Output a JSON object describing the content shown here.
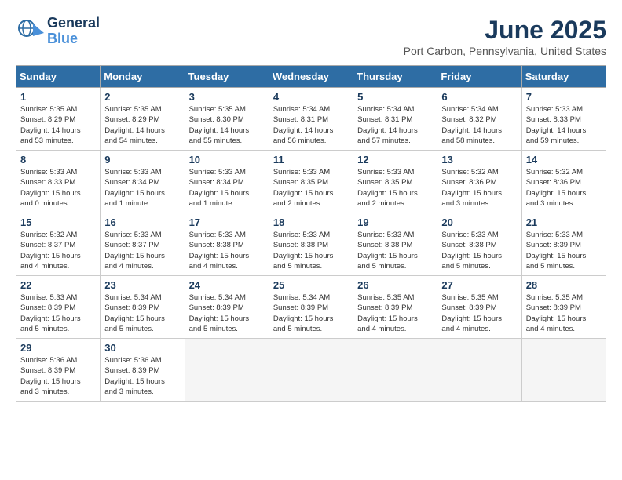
{
  "logo": {
    "general": "General",
    "blue": "Blue"
  },
  "title": {
    "month": "June 2025",
    "location": "Port Carbon, Pennsylvania, United States"
  },
  "calendar": {
    "headers": [
      "Sunday",
      "Monday",
      "Tuesday",
      "Wednesday",
      "Thursday",
      "Friday",
      "Saturday"
    ],
    "weeks": [
      [
        {
          "day": "",
          "empty": true
        },
        {
          "day": "",
          "empty": true
        },
        {
          "day": "",
          "empty": true
        },
        {
          "day": "",
          "empty": true
        },
        {
          "day": "",
          "empty": true
        },
        {
          "day": "",
          "empty": true
        },
        {
          "day": "",
          "empty": true
        }
      ],
      [
        {
          "day": "1",
          "info": "Sunrise: 5:35 AM\nSunset: 8:29 PM\nDaylight: 14 hours\nand 53 minutes."
        },
        {
          "day": "2",
          "info": "Sunrise: 5:35 AM\nSunset: 8:29 PM\nDaylight: 14 hours\nand 54 minutes."
        },
        {
          "day": "3",
          "info": "Sunrise: 5:35 AM\nSunset: 8:30 PM\nDaylight: 14 hours\nand 55 minutes."
        },
        {
          "day": "4",
          "info": "Sunrise: 5:34 AM\nSunset: 8:31 PM\nDaylight: 14 hours\nand 56 minutes."
        },
        {
          "day": "5",
          "info": "Sunrise: 5:34 AM\nSunset: 8:31 PM\nDaylight: 14 hours\nand 57 minutes."
        },
        {
          "day": "6",
          "info": "Sunrise: 5:34 AM\nSunset: 8:32 PM\nDaylight: 14 hours\nand 58 minutes."
        },
        {
          "day": "7",
          "info": "Sunrise: 5:33 AM\nSunset: 8:33 PM\nDaylight: 14 hours\nand 59 minutes."
        }
      ],
      [
        {
          "day": "8",
          "info": "Sunrise: 5:33 AM\nSunset: 8:33 PM\nDaylight: 15 hours\nand 0 minutes."
        },
        {
          "day": "9",
          "info": "Sunrise: 5:33 AM\nSunset: 8:34 PM\nDaylight: 15 hours\nand 1 minute."
        },
        {
          "day": "10",
          "info": "Sunrise: 5:33 AM\nSunset: 8:34 PM\nDaylight: 15 hours\nand 1 minute."
        },
        {
          "day": "11",
          "info": "Sunrise: 5:33 AM\nSunset: 8:35 PM\nDaylight: 15 hours\nand 2 minutes."
        },
        {
          "day": "12",
          "info": "Sunrise: 5:33 AM\nSunset: 8:35 PM\nDaylight: 15 hours\nand 2 minutes."
        },
        {
          "day": "13",
          "info": "Sunrise: 5:32 AM\nSunset: 8:36 PM\nDaylight: 15 hours\nand 3 minutes."
        },
        {
          "day": "14",
          "info": "Sunrise: 5:32 AM\nSunset: 8:36 PM\nDaylight: 15 hours\nand 3 minutes."
        }
      ],
      [
        {
          "day": "15",
          "info": "Sunrise: 5:32 AM\nSunset: 8:37 PM\nDaylight: 15 hours\nand 4 minutes."
        },
        {
          "day": "16",
          "info": "Sunrise: 5:33 AM\nSunset: 8:37 PM\nDaylight: 15 hours\nand 4 minutes."
        },
        {
          "day": "17",
          "info": "Sunrise: 5:33 AM\nSunset: 8:38 PM\nDaylight: 15 hours\nand 4 minutes."
        },
        {
          "day": "18",
          "info": "Sunrise: 5:33 AM\nSunset: 8:38 PM\nDaylight: 15 hours\nand 5 minutes."
        },
        {
          "day": "19",
          "info": "Sunrise: 5:33 AM\nSunset: 8:38 PM\nDaylight: 15 hours\nand 5 minutes."
        },
        {
          "day": "20",
          "info": "Sunrise: 5:33 AM\nSunset: 8:38 PM\nDaylight: 15 hours\nand 5 minutes."
        },
        {
          "day": "21",
          "info": "Sunrise: 5:33 AM\nSunset: 8:39 PM\nDaylight: 15 hours\nand 5 minutes."
        }
      ],
      [
        {
          "day": "22",
          "info": "Sunrise: 5:33 AM\nSunset: 8:39 PM\nDaylight: 15 hours\nand 5 minutes."
        },
        {
          "day": "23",
          "info": "Sunrise: 5:34 AM\nSunset: 8:39 PM\nDaylight: 15 hours\nand 5 minutes."
        },
        {
          "day": "24",
          "info": "Sunrise: 5:34 AM\nSunset: 8:39 PM\nDaylight: 15 hours\nand 5 minutes."
        },
        {
          "day": "25",
          "info": "Sunrise: 5:34 AM\nSunset: 8:39 PM\nDaylight: 15 hours\nand 5 minutes."
        },
        {
          "day": "26",
          "info": "Sunrise: 5:35 AM\nSunset: 8:39 PM\nDaylight: 15 hours\nand 4 minutes."
        },
        {
          "day": "27",
          "info": "Sunrise: 5:35 AM\nSunset: 8:39 PM\nDaylight: 15 hours\nand 4 minutes."
        },
        {
          "day": "28",
          "info": "Sunrise: 5:35 AM\nSunset: 8:39 PM\nDaylight: 15 hours\nand 4 minutes."
        }
      ],
      [
        {
          "day": "29",
          "info": "Sunrise: 5:36 AM\nSunset: 8:39 PM\nDaylight: 15 hours\nand 3 minutes."
        },
        {
          "day": "30",
          "info": "Sunrise: 5:36 AM\nSunset: 8:39 PM\nDaylight: 15 hours\nand 3 minutes."
        },
        {
          "day": "",
          "empty": true
        },
        {
          "day": "",
          "empty": true
        },
        {
          "day": "",
          "empty": true
        },
        {
          "day": "",
          "empty": true
        },
        {
          "day": "",
          "empty": true
        }
      ]
    ]
  }
}
